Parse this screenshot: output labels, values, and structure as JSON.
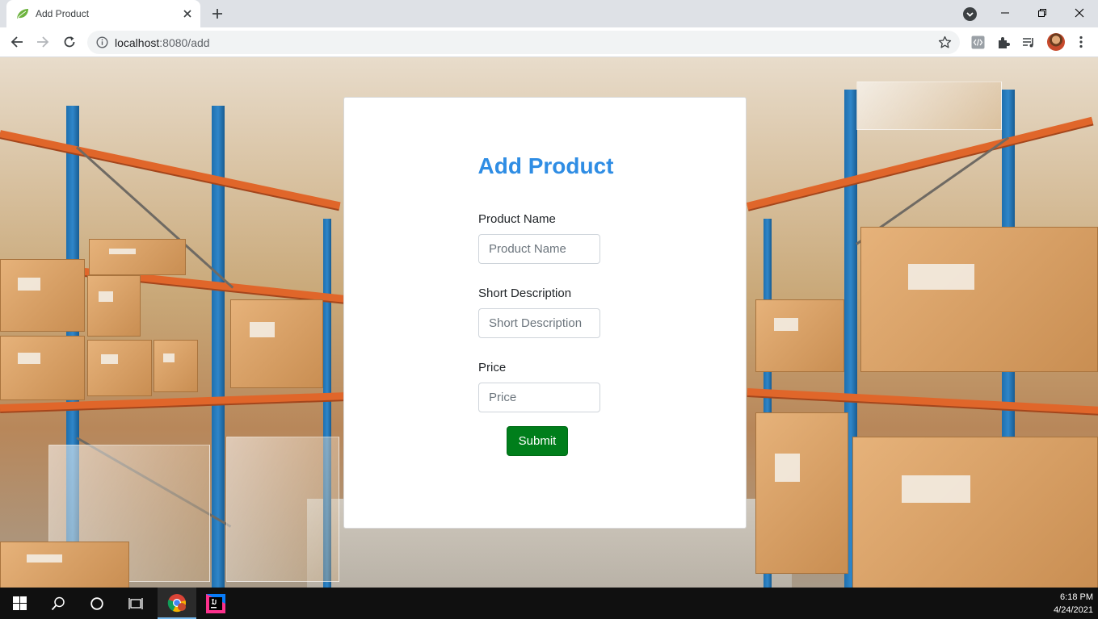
{
  "browser": {
    "tab_title": "Add Product",
    "url_host": "localhost",
    "url_path": ":8080/add"
  },
  "form": {
    "title": "Add Product",
    "fields": [
      {
        "label": "Product Name",
        "placeholder": "Product Name",
        "value": ""
      },
      {
        "label": "Short Description",
        "placeholder": "Short Description",
        "value": ""
      },
      {
        "label": "Price",
        "placeholder": "Price",
        "value": ""
      }
    ],
    "submit_label": "Submit"
  },
  "taskbar": {
    "time": "6:18 PM",
    "date": "4/24/2021"
  },
  "colors": {
    "title": "#2f8de4",
    "submit": "#007e1b",
    "taskbar": "#101010"
  }
}
